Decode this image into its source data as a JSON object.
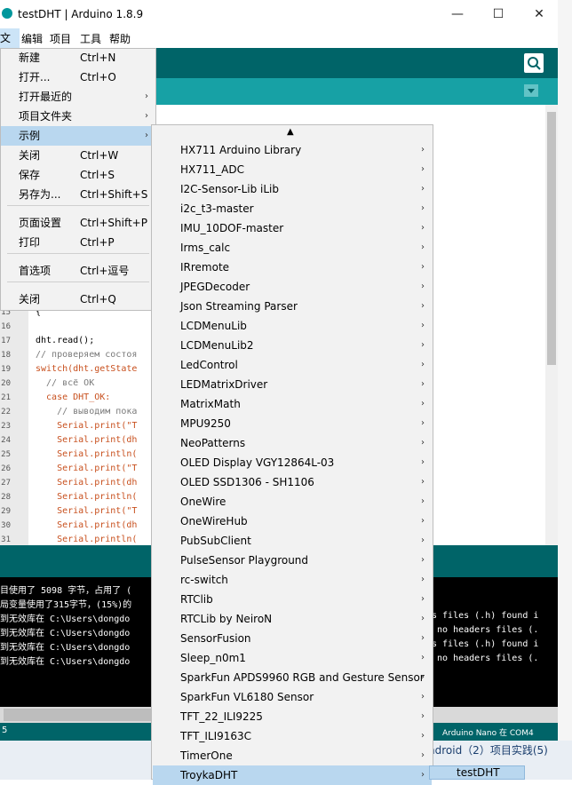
{
  "window": {
    "title": "testDHT | Arduino 1.8.9",
    "minimize": "—",
    "maximize": "☐",
    "close": "✕"
  },
  "menubar": [
    "文件",
    "编辑",
    "项目",
    "工具",
    "帮助"
  ],
  "file_menu": [
    {
      "label": "新建",
      "shortcut": "Ctrl+N"
    },
    {
      "label": "打开...",
      "shortcut": "Ctrl+O"
    },
    {
      "label": "打开最近的",
      "shortcut": "",
      "submenu": true
    },
    {
      "label": "项目文件夹",
      "shortcut": "",
      "submenu": true
    },
    {
      "label": "示例",
      "shortcut": "",
      "submenu": true,
      "highlighted": true
    },
    {
      "label": "关闭",
      "shortcut": "Ctrl+W"
    },
    {
      "label": "保存",
      "shortcut": "Ctrl+S"
    },
    {
      "label": "另存为...",
      "shortcut": "Ctrl+Shift+S"
    },
    {
      "label": "页面设置",
      "shortcut": "Ctrl+Shift+P"
    },
    {
      "label": "打印",
      "shortcut": "Ctrl+P"
    },
    {
      "label": "首选项",
      "shortcut": "Ctrl+逗号"
    },
    {
      "label": "关闭",
      "shortcut": "Ctrl+Q"
    }
  ],
  "examples_menu": {
    "scroll_up": "▲",
    "items": [
      "HX711 Arduino Library",
      "HX711_ADC",
      "I2C-Sensor-Lib iLib",
      "i2c_t3-master",
      "IMU_10DOF-master",
      "Irms_calc",
      "IRremote",
      "JPEGDecoder",
      "Json Streaming Parser",
      "LCDMenuLib",
      "LCDMenuLib2",
      "LedControl",
      "LEDMatrixDriver",
      "MatrixMath",
      "MPU9250",
      "NeoPatterns",
      "OLED Display VGY12864L-03",
      "OLED SSD1306 - SH1106",
      "OneWire",
      "OneWireHub",
      "PubSubClient",
      "PulseSensor Playground",
      "rc-switch",
      "RTClib",
      "RTCLib by NeiroN",
      "SensorFusion",
      "Sleep_n0m1",
      "SparkFun APDS9960 RGB and Gesture Sensor",
      "SparkFun VL6180 Sensor",
      "TFT_22_ILI9225",
      "TFT_ILI9163C",
      "TimerOne",
      "TroykaDHT"
    ],
    "arrow": "›",
    "sub_item": "testDHT"
  },
  "code": {
    "line_numbers": [
      "15",
      "16",
      "17",
      "18",
      "19",
      "20",
      "21",
      "22",
      "23",
      "24",
      "25",
      "26",
      "27",
      "28",
      "29",
      "30",
      "31"
    ],
    "lines": [
      "{",
      "",
      "dht.read();",
      "// проверяем состоя",
      "switch(dht.getState",
      "  // всё OK",
      "  case DHT_OK:",
      "    // выводим пока",
      "    Serial.print(\"T",
      "    Serial.print(dh",
      "    Serial.println(",
      "    Serial.print(\"T",
      "    Serial.print(dh",
      "    Serial.println(",
      "    Serial.print(\"T",
      "    Serial.print(dh",
      "    Serial.println("
    ]
  },
  "console": {
    "left_lines": [
      "目使用了 5098 字节，占用了 (",
      "局变量使用了315字节，(15%)的",
      "到无效库在 C:\\Users\\dongdo",
      "到无效库在 C:\\Users\\dongdo",
      "到无效库在 C:\\Users\\dongdo",
      "到无效库在 C:\\Users\\dongdo"
    ],
    "right_lines": [
      "",
      "",
      "s files (.h) found i",
      " no headers files (.",
      "s files (.h) found i",
      " no headers files (."
    ]
  },
  "status": {
    "line": "5",
    "board": "Arduino Nano 在 COM4"
  },
  "taskbar_text": "ndroid（2）项目实践(5)",
  "colors": {
    "toolbar": "#006468",
    "tabbar": "#17a1a5",
    "menu_highlight": "#b9d7ef"
  }
}
